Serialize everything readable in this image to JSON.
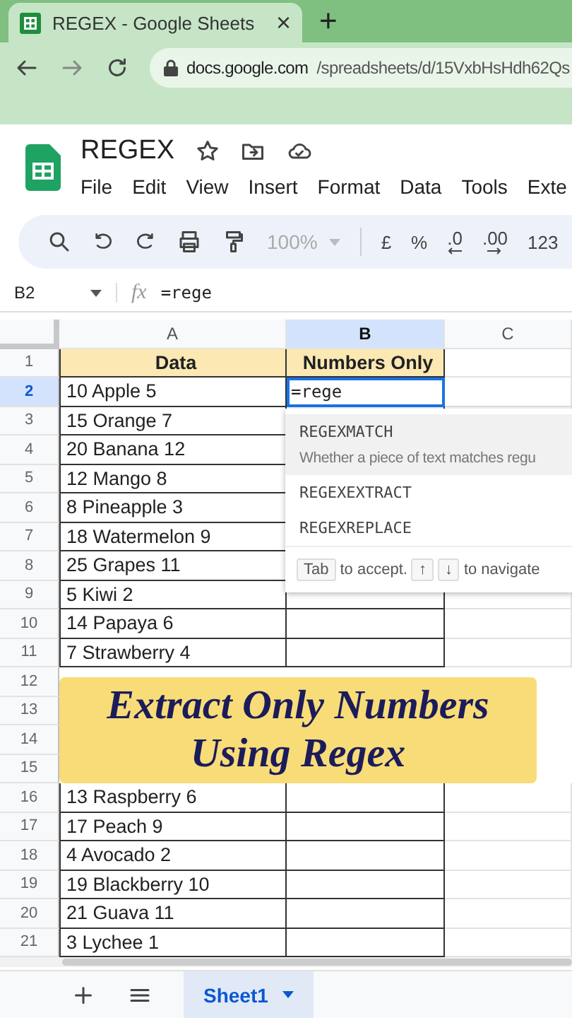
{
  "browser": {
    "tab_title": "REGEX - Google Sheets",
    "close": "×",
    "new_tab": "+",
    "url_host": "docs.google.com",
    "url_path": "/spreadsheets/d/15VxbHsHdh62Qs"
  },
  "doc": {
    "title": "REGEX",
    "menu": [
      "File",
      "Edit",
      "View",
      "Insert",
      "Format",
      "Data",
      "Tools",
      "Exte"
    ]
  },
  "toolbar": {
    "zoom": "100%",
    "buttons": [
      "£",
      "%",
      ".0",
      ".00",
      "123"
    ]
  },
  "formula_bar": {
    "cell_ref": "B2",
    "fx_label": "fx",
    "formula": "=rege"
  },
  "columns": [
    {
      "label": "A",
      "selected": false
    },
    {
      "label": "B",
      "selected": true
    },
    {
      "label": "C",
      "selected": false
    }
  ],
  "rows": [
    {
      "number": "1",
      "selected": false,
      "kind": "header",
      "a": "Data",
      "b": "Numbers Only"
    },
    {
      "number": "2",
      "selected": true,
      "kind": "editing",
      "a": "10 Apple 5",
      "b": "=rege"
    },
    {
      "number": "3",
      "selected": false,
      "kind": "data",
      "a": "15 Orange 7"
    },
    {
      "number": "4",
      "selected": false,
      "kind": "data",
      "a": "20 Banana 12"
    },
    {
      "number": "5",
      "selected": false,
      "kind": "data",
      "a": "12 Mango 8"
    },
    {
      "number": "6",
      "selected": false,
      "kind": "data",
      "a": "8 Pineapple 3"
    },
    {
      "number": "7",
      "selected": false,
      "kind": "data",
      "a": "18 Watermelon 9"
    },
    {
      "number": "8",
      "selected": false,
      "kind": "data",
      "a": "25 Grapes 11"
    },
    {
      "number": "9",
      "selected": false,
      "kind": "data",
      "a": "5 Kiwi 2"
    },
    {
      "number": "10",
      "selected": false,
      "kind": "data",
      "a": "14 Papaya 6"
    },
    {
      "number": "11",
      "selected": false,
      "kind": "data",
      "a": "7 Strawberry 4"
    },
    {
      "number": "12",
      "selected": false,
      "kind": "data"
    },
    {
      "number": "13",
      "selected": false,
      "kind": "data"
    },
    {
      "number": "14",
      "selected": false,
      "kind": "data"
    },
    {
      "number": "15",
      "selected": false,
      "kind": "data"
    },
    {
      "number": "16",
      "selected": false,
      "kind": "data",
      "a": "13 Raspberry 6"
    },
    {
      "number": "17",
      "selected": false,
      "kind": "data",
      "a": "17 Peach 9"
    },
    {
      "number": "18",
      "selected": false,
      "kind": "data",
      "a": "4 Avocado 2"
    },
    {
      "number": "19",
      "selected": false,
      "kind": "data",
      "a": "19 Blackberry 10"
    },
    {
      "number": "20",
      "selected": false,
      "kind": "data",
      "a": "21 Guava 11"
    },
    {
      "number": "21",
      "selected": false,
      "kind": "data",
      "a": "3 Lychee 1"
    }
  ],
  "autocomplete": {
    "items": [
      {
        "name": "REGEXMATCH",
        "description": "Whether a piece of text matches regu",
        "selected": true
      },
      {
        "name": "REGEXEXTRACT",
        "selected": false
      },
      {
        "name": "REGEXREPLACE",
        "selected": false
      }
    ],
    "hint": {
      "accept_key": "Tab",
      "accept_text": "to accept.",
      "up_key": "↑",
      "down_key": "↓",
      "navigate_text": "to navigate"
    }
  },
  "banner": {
    "lines": [
      "Extract Only Numbers",
      "Using Regex"
    ]
  },
  "sheet_tabs": [
    {
      "label": "Sheet1",
      "selected": true
    }
  ]
}
